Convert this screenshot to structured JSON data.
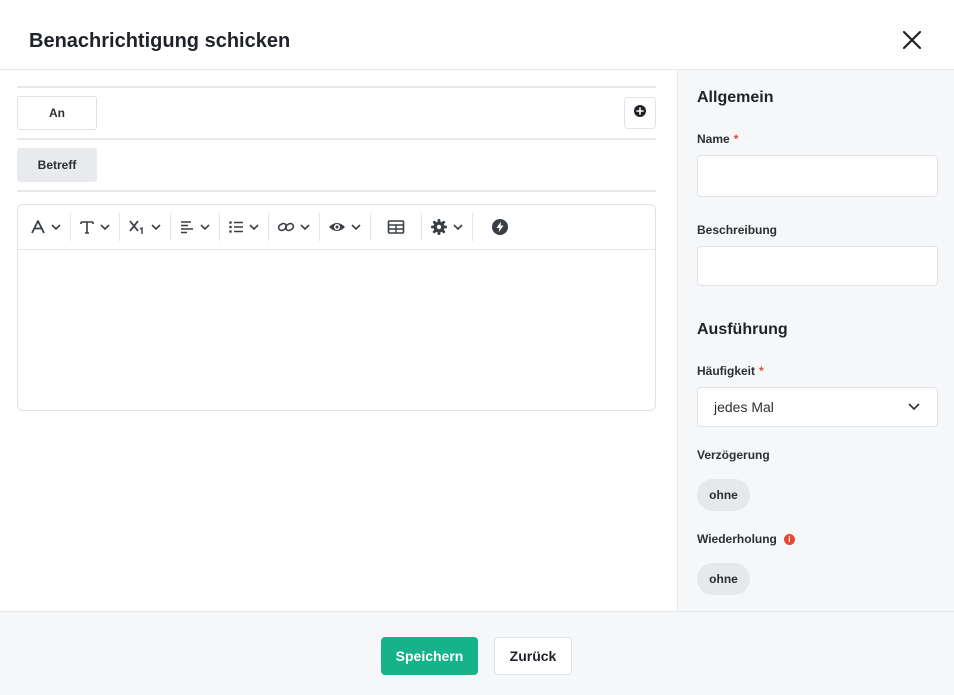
{
  "dialog": {
    "title": "Benachrichtigung schicken"
  },
  "icons": {
    "close": "close-icon",
    "add": "plus-circle-icon",
    "font_color": "font-color-icon",
    "font_size": "text-size-icon",
    "subscript": "subscript-icon",
    "align": "align-left-icon",
    "list": "list-icon",
    "link": "link-icon",
    "preview": "eye-icon",
    "table": "table-icon",
    "settings": "gear-icon",
    "power": "lightning-icon",
    "chevron": "chevron-down-icon",
    "info": "info-icon"
  },
  "composer": {
    "to_label": "An",
    "subject_label": "Betreff"
  },
  "sidebar": {
    "general_heading": "Allgemein",
    "name_label": "Name",
    "name_value": "",
    "description_label": "Beschreibung",
    "description_value": "",
    "execution_heading": "Ausführung",
    "frequency_label": "Häufigkeit",
    "frequency_value": "jedes Mal",
    "delay_label": "Verzögerung",
    "delay_value": "ohne",
    "repeat_label": "Wiederholung",
    "repeat_value": "ohne",
    "required_marker": "*",
    "info_glyph": "i"
  },
  "footer": {
    "save_label": "Speichern",
    "back_label": "Zurück"
  },
  "colors": {
    "primary": "#16b38a",
    "required": "#e5482e",
    "panel": "#f6f7f9"
  }
}
